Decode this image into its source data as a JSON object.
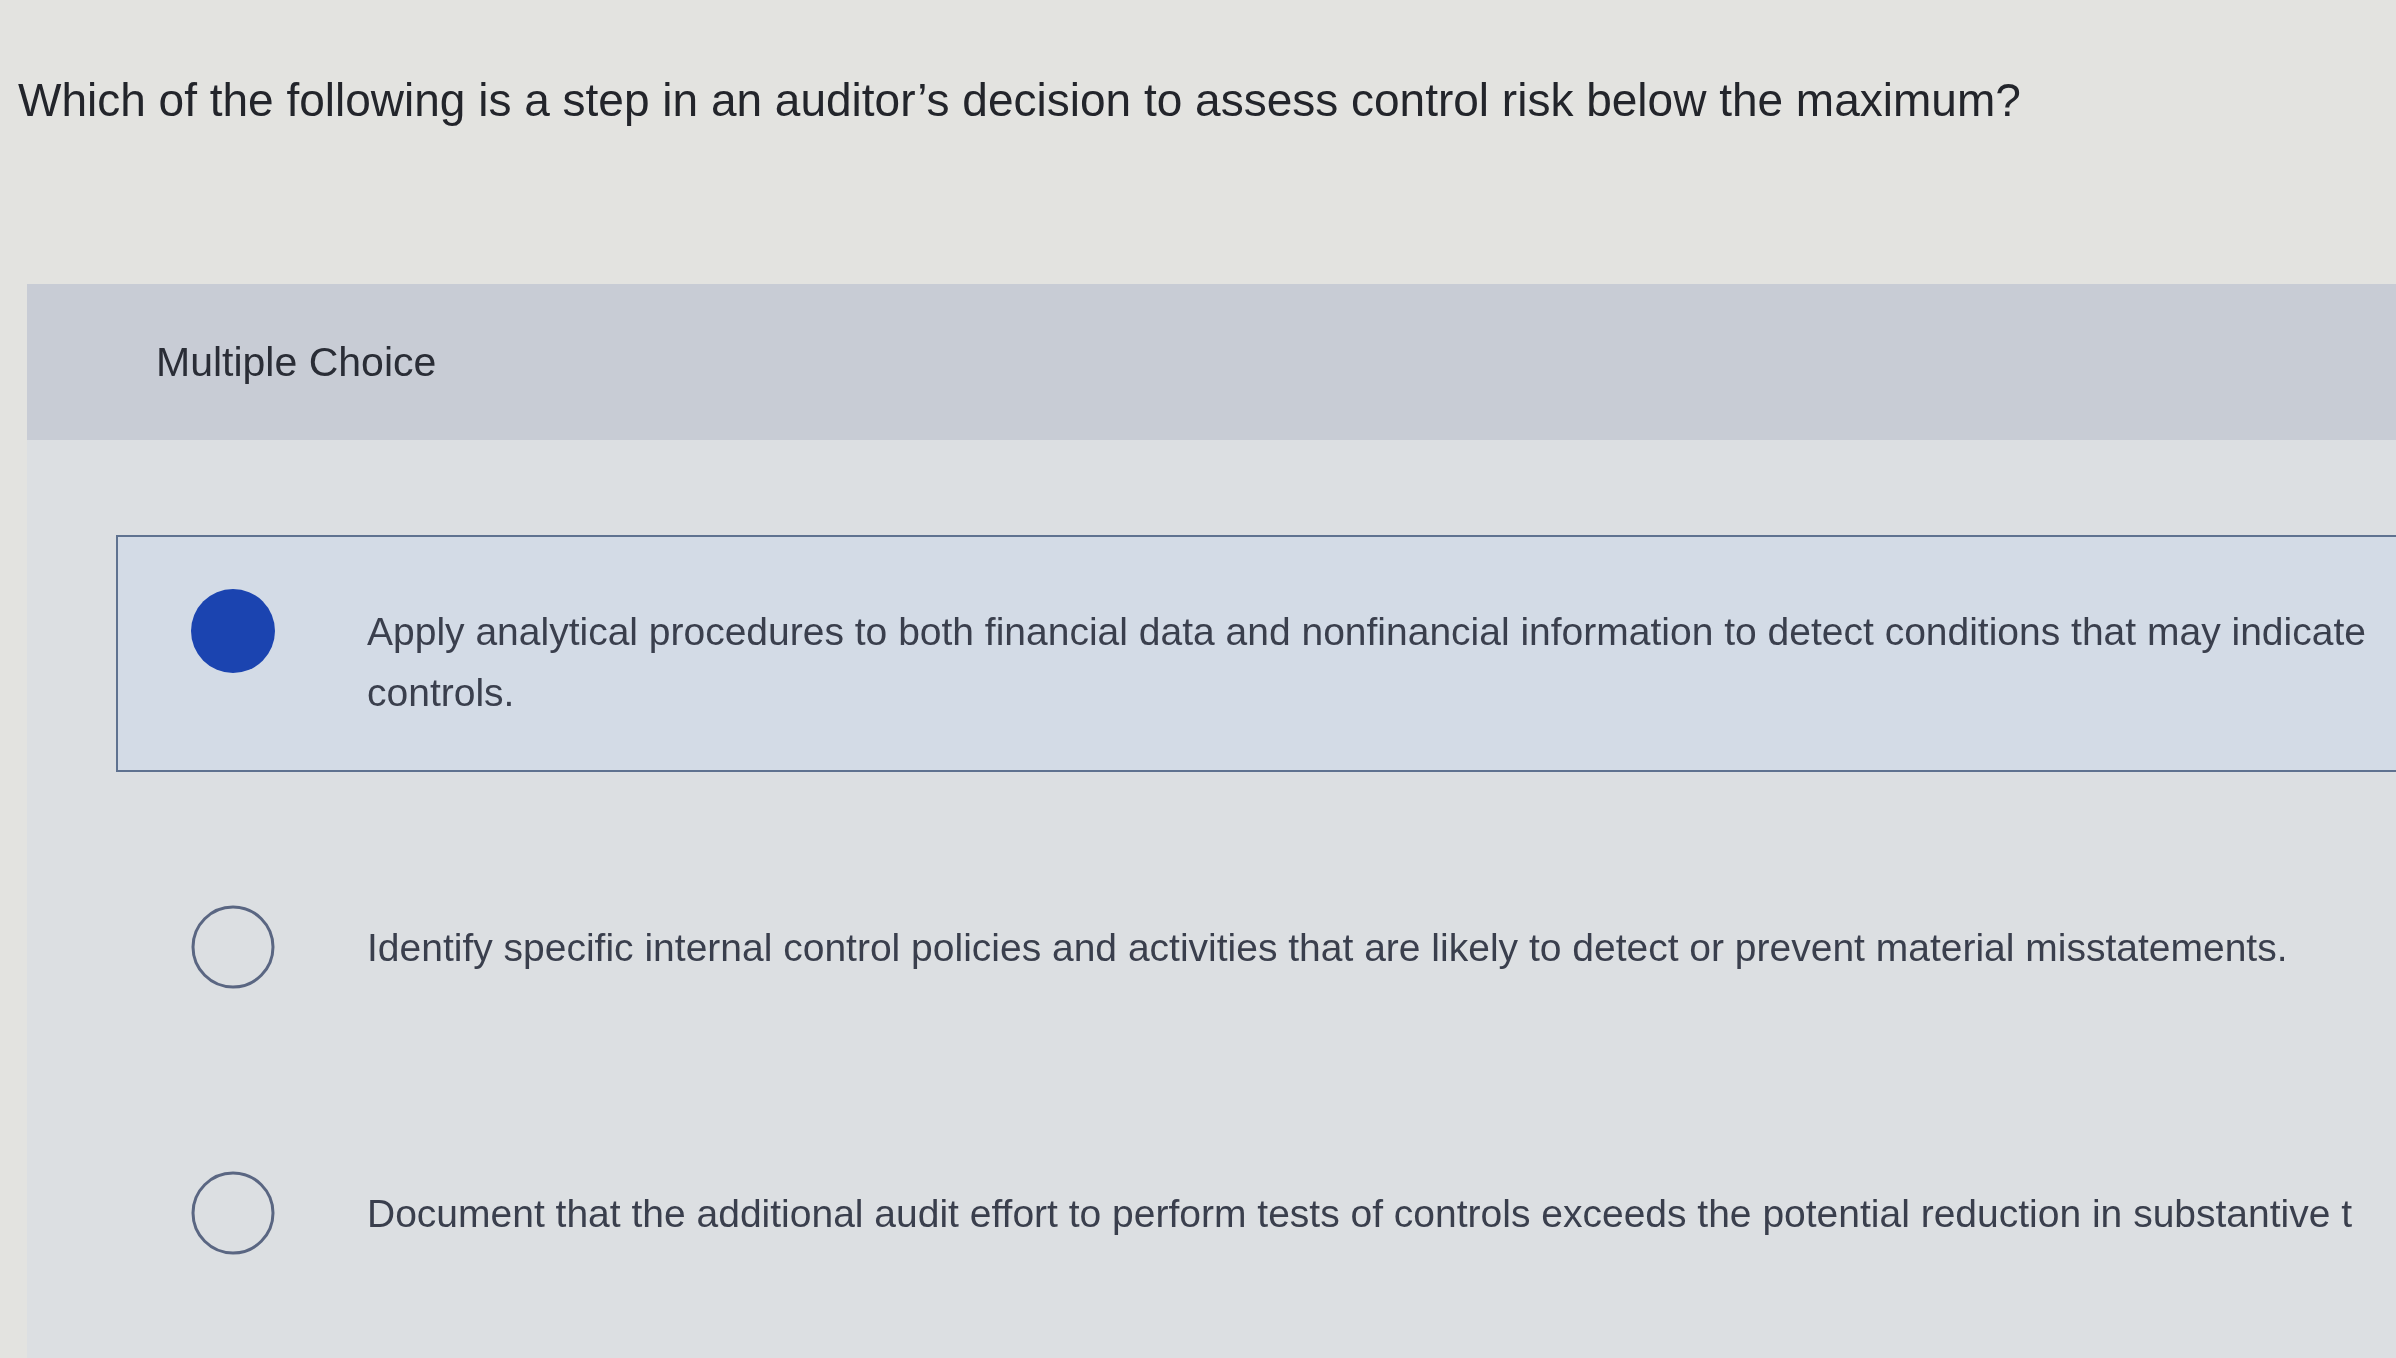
{
  "question": "Which of the following is a step in an auditor’s decision to assess control risk below the maximum?",
  "panel": {
    "title": "Multiple Choice"
  },
  "options": [
    {
      "lines": [
        "Apply analytical procedures to both financial data and nonfinancial information to detect conditions that may indicate",
        "controls."
      ],
      "selected": true
    },
    {
      "lines": [
        "Identify specific internal control policies and activities that are likely to detect or prevent material misstatements."
      ],
      "selected": false
    },
    {
      "lines": [
        "Document that the additional audit effort to perform tests of controls exceeds the potential reduction in substantive t"
      ],
      "selected": false
    }
  ]
}
